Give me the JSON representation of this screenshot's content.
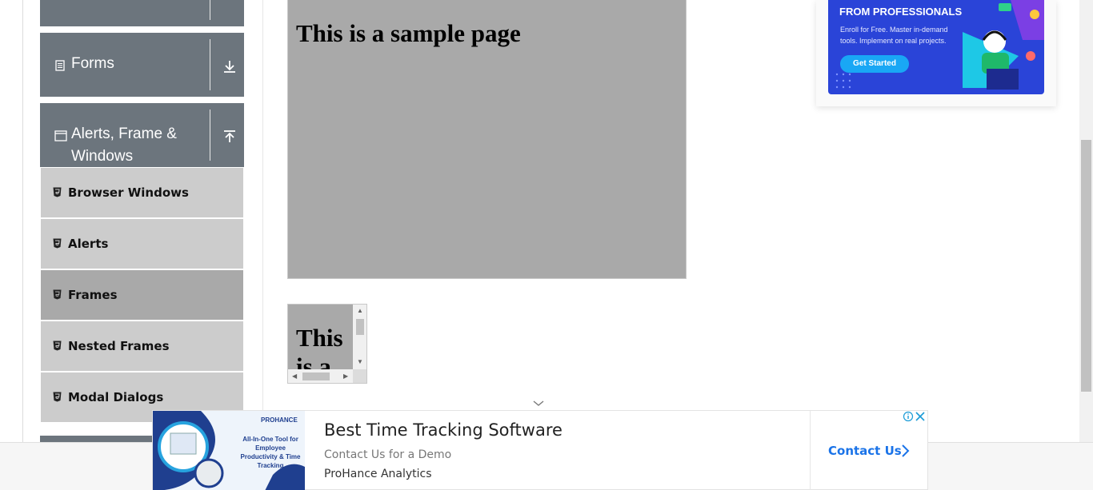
{
  "sidebar": {
    "groups": [
      {
        "label": "Forms",
        "icon": "document-icon",
        "arrow": "download-arrow-icon"
      },
      {
        "label": "Alerts, Frame &",
        "label_line2": "Windows",
        "icon": "window-icon",
        "arrow": "upload-arrow-icon"
      }
    ],
    "items": [
      {
        "label": "Browser Windows",
        "active": false
      },
      {
        "label": "Alerts",
        "active": false
      },
      {
        "label": "Frames",
        "active": true
      },
      {
        "label": "Nested Frames",
        "active": false
      },
      {
        "label": "Modal Dialogs",
        "active": false
      }
    ]
  },
  "main": {
    "frame1_heading": "This is a sample page",
    "frame2_heading": "This is a sample page"
  },
  "top_ad": {
    "heading": "FROM PROFESSIONALS",
    "subtitle": "Enroll for Free. Master in-demand tools. Implement on real projects.",
    "button": "Get Started"
  },
  "bottom_ad": {
    "thumb_brand": "PROHANCE",
    "thumb_text": "All-In-One Tool for Employee Productivity & Time Tracking",
    "title": "Best Time Tracking Software",
    "description": "Contact Us for a Demo",
    "brand": "ProHance Analytics",
    "cta": "Contact Us"
  },
  "colors": {
    "group_header_bg": "#6c757d",
    "menu_item_bg": "#cccccc",
    "menu_item_active_bg": "#a9a9a9",
    "frame_bg": "#a9a9a9",
    "ad_blue": "#2a44d8",
    "cta_blue": "#1a73e8"
  }
}
